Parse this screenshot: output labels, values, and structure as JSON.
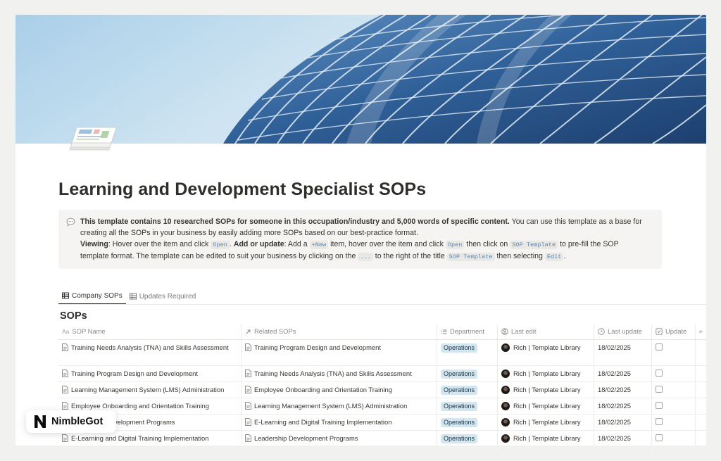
{
  "page": {
    "title": "Learning and Development Specialist SOPs"
  },
  "callout": {
    "line1_bold": "This template contains 10 researched SOPs for someone in this occupation/industry and 5,000 words of specific content.",
    "line1_rest": " You can use this template as a base for",
    "line2": "creating all the SOPs in your business by easily adding more SOPs based on our best-practice format.",
    "viewing_label": "Viewing",
    "viewing_text": ": Hover over the item and click ",
    "open_code": "Open",
    "dot": ". ",
    "add_label": "Add or update",
    "add_text1": ": Add a ",
    "new_code": "+New",
    "add_text2": " item, hover over the item and click ",
    "add_text3": " then click on ",
    "sop_template_code": "SOP Template",
    "add_text4": " to pre-fill the SOP",
    "line4_text1": "template format. The template can be edited to suit your business by clicking on the ",
    "dots_code": "...",
    "line4_text2": " to the right of the title ",
    "line4_text3": " then selecting ",
    "edit_code": "Edit",
    "line4_end": "."
  },
  "tabs": [
    {
      "label": "Company SOPs",
      "active": true
    },
    {
      "label": "Updates Required",
      "active": false
    }
  ],
  "database": {
    "title": "SOPs",
    "columns": {
      "name": "SOP Name",
      "related": "Related SOPs",
      "department": "Department",
      "last_edit": "Last edit",
      "last_update": "Last update",
      "update": "Update"
    },
    "name_icon_text": "Aa",
    "rows": [
      {
        "name": "Training Needs Analysis (TNA) and Skills Assessment",
        "related": "Training Program Design and Development",
        "department": "Operations",
        "editor": "Rich | Template Library",
        "date": "18/02/2025"
      },
      {
        "name": "Training Program Design and Development",
        "related": "Training Needs Analysis (TNA) and Skills Assessment",
        "department": "Operations",
        "editor": "Rich | Template Library",
        "date": "18/02/2025"
      },
      {
        "name": "Learning Management System (LMS) Administration",
        "related": "Employee Onboarding and Orientation Training",
        "department": "Operations",
        "editor": "Rich | Template Library",
        "date": "18/02/2025"
      },
      {
        "name": "Employee Onboarding and Orientation Training",
        "related": "Learning Management System (LMS) Administration",
        "department": "Operations",
        "editor": "Rich | Template Library",
        "date": "18/02/2025"
      },
      {
        "name": "Leadership Development Programs",
        "related": "E-Learning and Digital Training Implementation",
        "department": "Operations",
        "editor": "Rich | Template Library",
        "date": "18/02/2025"
      },
      {
        "name": "E-Learning and Digital Training Implementation",
        "related": "Leadership Development Programs",
        "department": "Operations",
        "editor": "Rich | Template Library",
        "date": "18/02/2025"
      }
    ]
  },
  "brand": {
    "name": "NimbleGot"
  },
  "colors": {
    "department_badge_bg": "#d3e5ef",
    "code_text": "#5a86b0"
  }
}
